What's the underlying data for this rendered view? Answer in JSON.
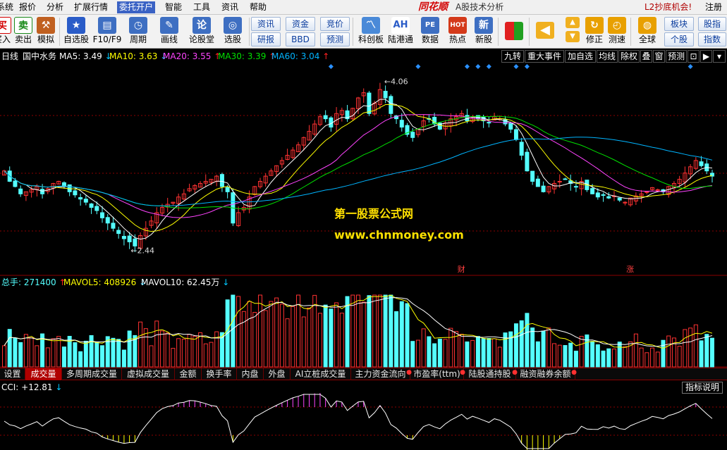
{
  "menubar": {
    "items": [
      {
        "label": "系统"
      },
      {
        "label": "报价"
      },
      {
        "label": "分析"
      },
      {
        "label": "扩展行情"
      },
      {
        "label": "委托开户"
      },
      {
        "label": "智能"
      },
      {
        "label": "工具"
      },
      {
        "label": "资讯"
      },
      {
        "label": "帮助"
      }
    ],
    "active_index": 4,
    "logo": "同花顺",
    "app_title": "A股技术分析",
    "promo": "L2抄底机会!",
    "register": "注册"
  },
  "toolbar": {
    "buttons": [
      {
        "label": "买入",
        "icon": "buy-icon",
        "glyph": "买",
        "color": "#d40000"
      },
      {
        "label": "卖出",
        "icon": "sell-icon",
        "glyph": "卖",
        "color": "#1a8a1a"
      },
      {
        "label": "模拟",
        "icon": "gavel-icon",
        "glyph": "⚒",
        "color": "#c06020"
      },
      {
        "label": "自选股",
        "icon": "favorite-star-icon",
        "glyph": "★",
        "color": "#2a5cc8"
      },
      {
        "label": "F10/F9",
        "icon": "f10-document-icon",
        "glyph": "▤",
        "color": "#3e6fc2"
      },
      {
        "label": "周期",
        "icon": "clock-icon",
        "glyph": "◷",
        "color": "#3e6fc2"
      },
      {
        "label": "画线",
        "icon": "pencil-icon",
        "glyph": "✎",
        "color": "#3e6fc2"
      },
      {
        "label": "论股堂",
        "icon": "discussion-icon",
        "glyph": "论",
        "color": "#3e6fc2"
      },
      {
        "label": "选股",
        "icon": "stock-screen-icon",
        "glyph": "◎",
        "color": "#3e6fc2"
      },
      {
        "label": "科创板",
        "icon": "star-market-icon",
        "glyph": "〽",
        "color": "#4a8ad8"
      },
      {
        "label": "陆港通",
        "icon": "ah-icon",
        "glyph": "AH",
        "color": "#2a5cc8"
      },
      {
        "label": "数据",
        "icon": "pe-data-icon",
        "glyph": "PE",
        "color": "#3e6fc2"
      },
      {
        "label": "热点",
        "icon": "hot-icon",
        "glyph": "HOT",
        "color": "#d43a1a"
      },
      {
        "label": "新股",
        "icon": "ipo-icon",
        "glyph": "新",
        "color": "#3e6fc2"
      },
      {
        "label": "修正",
        "icon": "correction-icon",
        "glyph": "↻",
        "color": "#e8a000"
      },
      {
        "label": "测速",
        "icon": "speed-test-icon",
        "glyph": "◴",
        "color": "#e8a000"
      },
      {
        "label": "全球",
        "icon": "globe-icon",
        "glyph": "◍",
        "color": "#e8a000"
      }
    ],
    "small_buttons": [
      {
        "label": "资讯"
      },
      {
        "label": "研报"
      },
      {
        "label": "资金"
      },
      {
        "label": "BBD"
      },
      {
        "label": "竞价"
      },
      {
        "label": "预测"
      },
      {
        "label": "板块"
      },
      {
        "label": "个股"
      },
      {
        "label": "股指"
      },
      {
        "label": "指数"
      }
    ]
  },
  "chart_header": {
    "period": "日线",
    "stock": "国中水务",
    "ma": [
      {
        "label": "MA5: 3.49",
        "arrow": "↓",
        "color": "#ffffff",
        "arrow_color": "#00c8ff"
      },
      {
        "label": "MA10: 3.63",
        "arrow": "↓",
        "color": "#ffff00",
        "arrow_color": "#00c8ff"
      },
      {
        "label": "MA20: 3.55",
        "arrow": "↑",
        "color": "#ff44ff",
        "arrow_color": "#ff2020"
      },
      {
        "label": "MA30: 3.39",
        "arrow": "↑",
        "color": "#00e000",
        "arrow_color": "#ff2020"
      },
      {
        "label": "MA60: 3.04",
        "arrow": "↑",
        "color": "#00b4ff",
        "arrow_color": "#ff2020"
      }
    ],
    "right_buttons": [
      {
        "label": "九转"
      },
      {
        "label": "重大事件"
      },
      {
        "label": "加自选"
      },
      {
        "label": "均线"
      },
      {
        "label": "除权"
      },
      {
        "label": "叠"
      },
      {
        "label": "窗"
      },
      {
        "label": "预测"
      }
    ],
    "lock_icon": "lock-icon",
    "more_icon": "more-arrows-icon"
  },
  "price_labels": {
    "high": "4.06",
    "low": "2.44"
  },
  "markers": {
    "cai": "财",
    "zhang": "涨"
  },
  "watermark": {
    "line1": "第一股票公式网",
    "line2": "www.chnmoney.com"
  },
  "volume_header": {
    "total": "总手: 271400",
    "total_arrow": "↑",
    "mavol5": "MAVOL5: 408926",
    "mavol5_arrow": "↓",
    "mavol10": "MAVOL10: 62.45万",
    "mavol10_arrow": "↓"
  },
  "tabs": [
    {
      "label": "设置",
      "dot": false
    },
    {
      "label": "成交量",
      "dot": false
    },
    {
      "label": "多周期成交量",
      "dot": false
    },
    {
      "label": "虚拟成交量",
      "dot": false
    },
    {
      "label": "金额",
      "dot": false
    },
    {
      "label": "换手率",
      "dot": false
    },
    {
      "label": "内盘",
      "dot": false
    },
    {
      "label": "外盘",
      "dot": false
    },
    {
      "label": "AI立桩成交量",
      "dot": false
    },
    {
      "label": "主力资金流向",
      "dot": true
    },
    {
      "label": "市盈率(ttm)",
      "dot": true
    },
    {
      "label": "陆股通持股",
      "dot": true
    },
    {
      "label": "融资融券余额",
      "dot": true
    }
  ],
  "active_tab": 1,
  "cci_header": {
    "label": "CCI: +12.81",
    "arrow": "↓",
    "help": "指标说明"
  },
  "colors": {
    "up": "#ff3232",
    "down": "#54ffff",
    "ma5": "#ffffff",
    "ma10": "#ffff00",
    "ma20": "#ff44ff",
    "ma30": "#00e000",
    "ma60": "#00b4ff",
    "grid": "#8b0000",
    "event_diamond": "#2a90ff"
  },
  "chart_data": {
    "type": "candlestick",
    "price_range": [
      2.3,
      4.15
    ],
    "high": 4.06,
    "low": 2.44,
    "closes": [
      3.2,
      3.1,
      3.05,
      2.98,
      3.0,
      3.02,
      3.05,
      2.98,
      3.03,
      3.08,
      3.1,
      3.05,
      3.0,
      2.97,
      2.93,
      2.9,
      2.85,
      2.82,
      2.75,
      2.7,
      2.65,
      2.6,
      2.55,
      2.52,
      2.48,
      2.58,
      2.65,
      2.72,
      2.8,
      2.85,
      2.88,
      2.9,
      2.95,
      2.98,
      3.03,
      3.06,
      3.08,
      3.1,
      3.12,
      3.15,
      3.05,
      3.0,
      2.7,
      2.8,
      2.85,
      2.95,
      3.05,
      3.1,
      3.15,
      3.2,
      3.25,
      3.3,
      3.35,
      3.4,
      3.45,
      3.52,
      3.58,
      3.65,
      3.72,
      3.7,
      3.62,
      3.75,
      3.78,
      3.7,
      3.8,
      3.9,
      3.95,
      3.75,
      3.85,
      3.98,
      3.9,
      3.75,
      3.7,
      3.62,
      3.55,
      3.52,
      3.6,
      3.68,
      3.7,
      3.65,
      3.6,
      3.66,
      3.7,
      3.72,
      3.75,
      3.68,
      3.72,
      3.7,
      3.68,
      3.66,
      3.72,
      3.7,
      3.65,
      3.6,
      3.5,
      3.35,
      3.2,
      3.1,
      3.05,
      3.0,
      3.05,
      3.08,
      3.1,
      3.12,
      3.08,
      3.05,
      3.1,
      3.02,
      2.98,
      2.95,
      2.97,
      2.94,
      2.96,
      2.92,
      2.9,
      2.94,
      2.96,
      2.98,
      3.0,
      3.04,
      3.02,
      3.0,
      3.05,
      3.08,
      3.12,
      3.18,
      3.24,
      3.3,
      3.25,
      3.2,
      3.15
    ],
    "ma_last": {
      "ma5": 3.49,
      "ma10": 3.63,
      "ma20": 3.55,
      "ma30": 3.39,
      "ma60": 3.04
    },
    "volume_last": 271400,
    "mavol5": 408926,
    "mavol10": 624500,
    "cci_last": 12.81
  }
}
